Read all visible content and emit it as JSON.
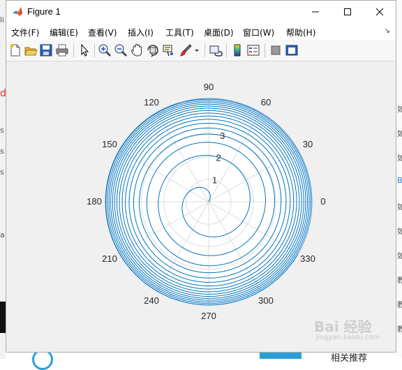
{
  "window": {
    "title": "Figure 1",
    "app_icon": "matlab-logo-icon",
    "controls": [
      "minimize-icon",
      "maximize-icon",
      "close-icon"
    ]
  },
  "menu": [
    "文件(F)",
    "编辑(E)",
    "查看(V)",
    "插入(I)",
    "工具(T)",
    "桌面(D)",
    "窗口(W)",
    "帮助(H)"
  ],
  "toolbar": [
    "new-figure-icon",
    "open-file-icon",
    "save-icon",
    "print-icon",
    "select-arrow-icon",
    "zoom-in-icon",
    "zoom-out-icon",
    "pan-hand-icon",
    "rotate-3d-icon",
    "data-cursor-icon",
    "brush-icon",
    "brush-dropdown-icon",
    "link-plot-icon",
    "colorbar-icon",
    "legend-icon",
    "hide-plot-tools-icon",
    "show-plot-tools-icon"
  ],
  "chart_data": {
    "type": "polar-line",
    "title": "",
    "function": "r = log(theta)",
    "theta_range_rad": [
      1.0,
      100.0
    ],
    "rlim": [
      0,
      4.6
    ],
    "r_ticks": [
      1,
      2,
      3
    ],
    "theta_ticks_deg": [
      0,
      30,
      60,
      90,
      120,
      150,
      180,
      210,
      240,
      270,
      300,
      330
    ],
    "theta_tick_labels": [
      "0",
      "30",
      "60",
      "90",
      "120",
      "150",
      "180",
      "210",
      "240",
      "270",
      "300",
      "330"
    ],
    "r_tick_labels": [
      "1",
      "2",
      "3"
    ],
    "line_color": "#0072bd",
    "grid": true
  },
  "background": {
    "left_fragments": [
      "li",
      "d",
      "、",
      "s",
      "、",
      "s",
      "、",
      "s",
      "、",
      "a"
    ],
    "right_fragments": [
      "如",
      "如",
      "如",
      "B",
      "如",
      "如",
      "如",
      "教",
      "教",
      "教"
    ],
    "watermark": "Bai 经验",
    "watermark_url": "jingyan.baidu.com",
    "footer_fragment": "相关推荐"
  }
}
